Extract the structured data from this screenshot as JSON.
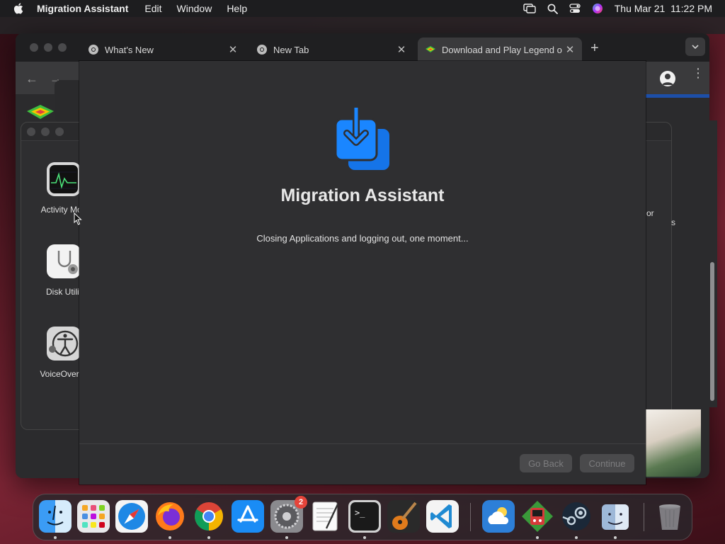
{
  "menubar": {
    "app_name": "Migration Assistant",
    "items": [
      "Edit",
      "Window",
      "Help"
    ],
    "datetime": "Thu Mar 21  11:22 PM"
  },
  "browser": {
    "tabs": [
      {
        "label": "What's New"
      },
      {
        "label": "New Tab"
      },
      {
        "label": "Download and Play Legend o"
      }
    ]
  },
  "utilities": {
    "apps": [
      {
        "label": "Activity Mon",
        "icon": "activity-monitor-icon"
      },
      {
        "label": "Disk Utilit",
        "icon": "disk-utility-icon"
      },
      {
        "label": "VoiceOver U",
        "icon": "voiceover-utility-icon"
      }
    ],
    "right_fragments": [
      "or",
      "s"
    ]
  },
  "migration_assistant": {
    "title": "Migration Assistant",
    "message": "Closing Applications and logging out, one moment...",
    "go_back_label": "Go Back",
    "continue_label": "Continue",
    "accent_color": "#1a7ff5"
  },
  "dock": {
    "apps": [
      {
        "name": "Finder",
        "icon": "finder-icon",
        "running": true
      },
      {
        "name": "Launchpad",
        "icon": "launchpad-icon",
        "running": false
      },
      {
        "name": "Safari",
        "icon": "safari-icon",
        "running": false
      },
      {
        "name": "Firefox",
        "icon": "firefox-icon",
        "running": true
      },
      {
        "name": "Chrome",
        "icon": "chrome-icon",
        "running": true
      },
      {
        "name": "App Store",
        "icon": "app-store-icon",
        "running": false
      },
      {
        "name": "System Settings",
        "icon": "system-settings-icon",
        "running": true,
        "badge": "2"
      },
      {
        "name": "TextEdit",
        "icon": "textedit-icon",
        "running": false
      },
      {
        "name": "Terminal",
        "icon": "terminal-icon",
        "running": true
      },
      {
        "name": "GarageBand",
        "icon": "garageband-icon",
        "running": false
      },
      {
        "name": "VS Code",
        "icon": "vscode-icon",
        "running": false
      },
      {
        "name": "Weather",
        "icon": "weather-icon",
        "running": false
      },
      {
        "name": "Game",
        "icon": "game-icon",
        "running": true
      },
      {
        "name": "Steam",
        "icon": "steam-icon",
        "running": true
      },
      {
        "name": "Migration Assistant",
        "icon": "migration-assistant-icon",
        "running": true
      },
      {
        "name": "Trash",
        "icon": "trash-icon",
        "running": false
      }
    ]
  }
}
